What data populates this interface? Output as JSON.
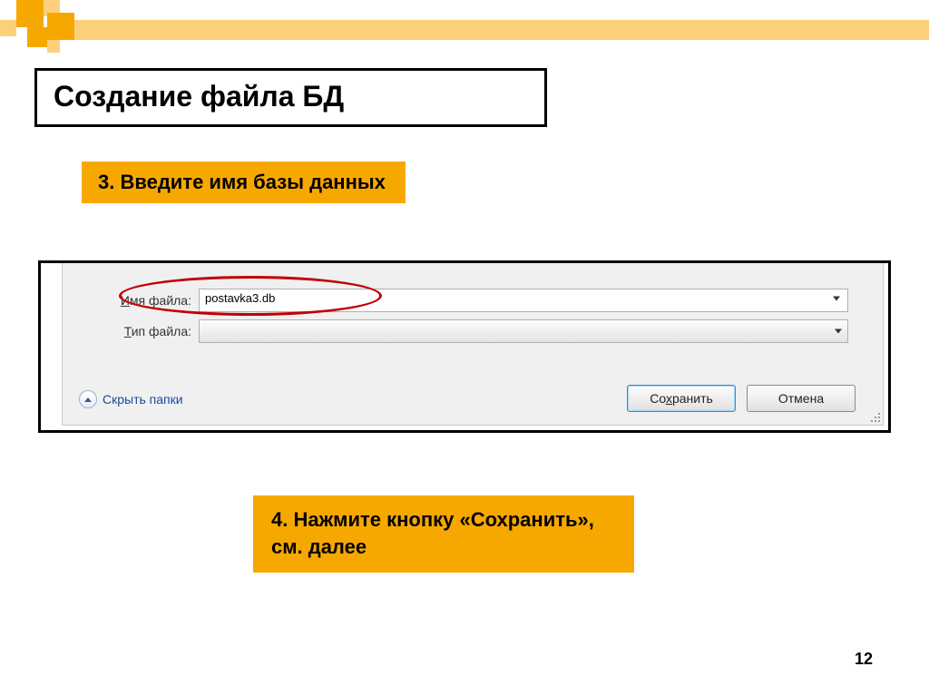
{
  "slide": {
    "title": "Создание файла БД",
    "step3": "3. Введите имя базы данных",
    "step4": "4. Нажмите кнопку «Сохранить», см. далее",
    "page_number": "12"
  },
  "dialog": {
    "filename_label": "Имя файла:",
    "filename_value": "postavka3.db",
    "filetype_label": "Тип файла:",
    "filetype_value": "",
    "hide_folders": "Скрыть папки",
    "save_button": "Сохранить",
    "cancel_button": "Отмена"
  }
}
